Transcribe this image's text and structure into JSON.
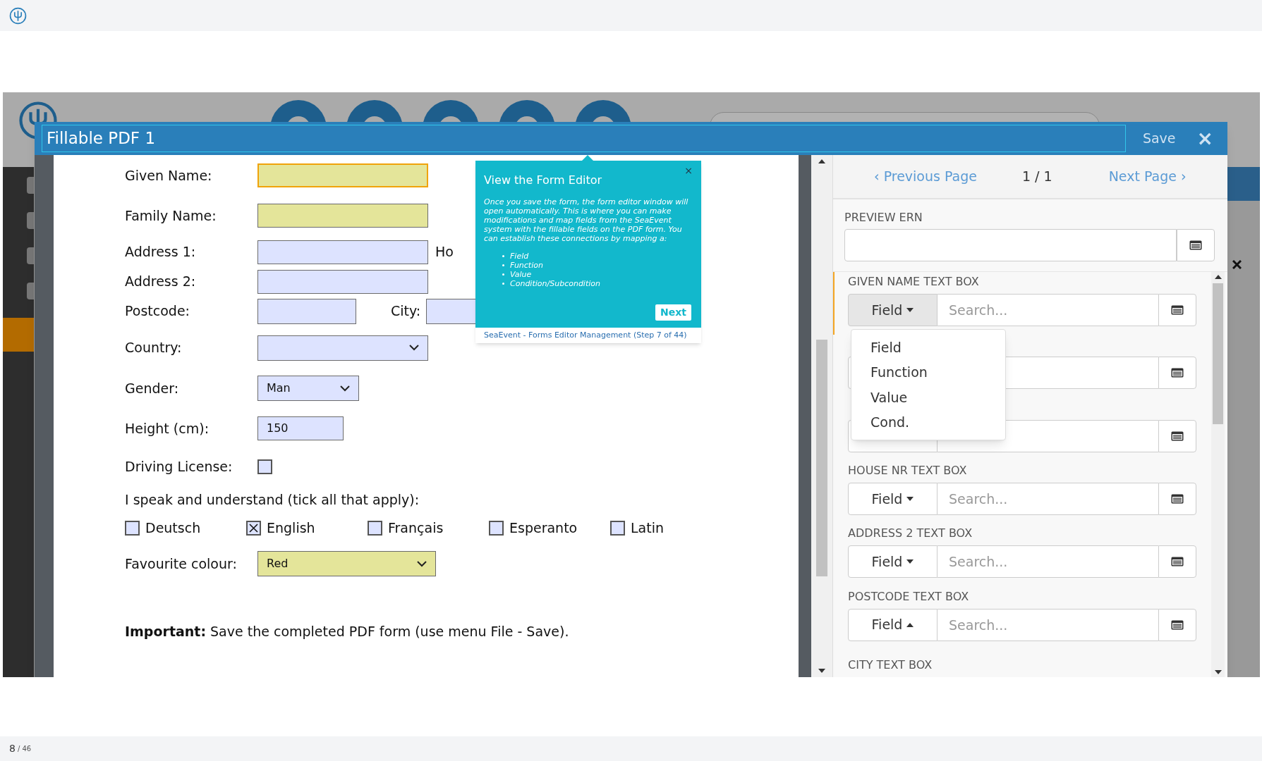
{
  "window": {
    "title": "Fillable PDF 1",
    "save": "Save",
    "close": "×"
  },
  "form": {
    "rows": [
      {
        "kind": "input",
        "label": "Given Name:",
        "required": true,
        "focused": true
      },
      {
        "kind": "input",
        "label": "Family Name:",
        "required": true,
        "focused": false
      },
      {
        "kind": "input",
        "label": "Address 1:",
        "required": false,
        "focused": false,
        "trailing": "Ho"
      },
      {
        "kind": "input",
        "label": "Address 2:",
        "required": false,
        "focused": false
      },
      {
        "kind": "pair",
        "label": "Postcode:",
        "label2": "City:"
      },
      {
        "kind": "select",
        "label": "Country:",
        "required": false
      },
      {
        "kind": "select",
        "label": "Gender:",
        "value": "Man",
        "required": false
      },
      {
        "kind": "input",
        "label": "Height (cm):",
        "value": "150",
        "required": false,
        "focused": false
      },
      {
        "kind": "checkbox",
        "label": "Driving License:",
        "checked": false
      },
      {
        "kind": "checklist",
        "label": "I speak and understand (tick all that apply):",
        "options": [
          {
            "label": "Deutsch",
            "checked": false
          },
          {
            "label": "English",
            "checked": true
          },
          {
            "label": "Français",
            "checked": false
          },
          {
            "label": "Esperanto",
            "checked": false
          },
          {
            "label": "Latin",
            "checked": false
          }
        ]
      },
      {
        "kind": "select",
        "label": "Favourite colour:",
        "value": "Red",
        "required": true
      }
    ],
    "note": "**Important:** Save the completed PDF form (use menu File - Save)."
  },
  "tour": {
    "title": "View the Form Editor",
    "close": "×",
    "body": "Once you save the form, the form editor window will open automatically. This is where you can make modifications and map fields from the SeaEvent system with the fillable fields on the PDF form. You can establish these connections by mapping a:",
    "bullets": [
      "Field",
      "Function",
      "Value",
      "Condition/Subcondition"
    ],
    "next": "Next",
    "footer": "SeaEvent - Forms Editor Management (Step 7 of 44)"
  },
  "panel": {
    "prev": "‹ Previous Page",
    "page": "1 / 1",
    "next": "Next Page ›",
    "preview_label": "PREVIEW ERN",
    "mappings": [
      {
        "kind": "visible",
        "label": "GIVEN NAME TEXT BOX",
        "type": "Field",
        "placeholder": "Search...",
        "highlighted": true,
        "caret_up": false
      },
      {
        "kind": "covered"
      },
      {
        "kind": "covered"
      },
      {
        "kind": "visible",
        "label": "HOUSE NR TEXT BOX",
        "type": "Field",
        "placeholder": "Search...",
        "highlighted": false,
        "caret_up": false
      },
      {
        "kind": "visible",
        "label": "ADDRESS 2 TEXT BOX",
        "type": "Field",
        "placeholder": "Search...",
        "highlighted": false,
        "caret_up": false
      },
      {
        "kind": "visible",
        "label": "POSTCODE TEXT BOX",
        "type": "Field",
        "placeholder": "Search...",
        "highlighted": false,
        "caret_up": true
      },
      {
        "kind": "label_only",
        "label": "CITY TEXT BOX"
      }
    ],
    "menu": [
      "Field",
      "Function",
      "Value",
      "Cond."
    ]
  },
  "pager": {
    "current": "8",
    "total": "/ 46"
  }
}
